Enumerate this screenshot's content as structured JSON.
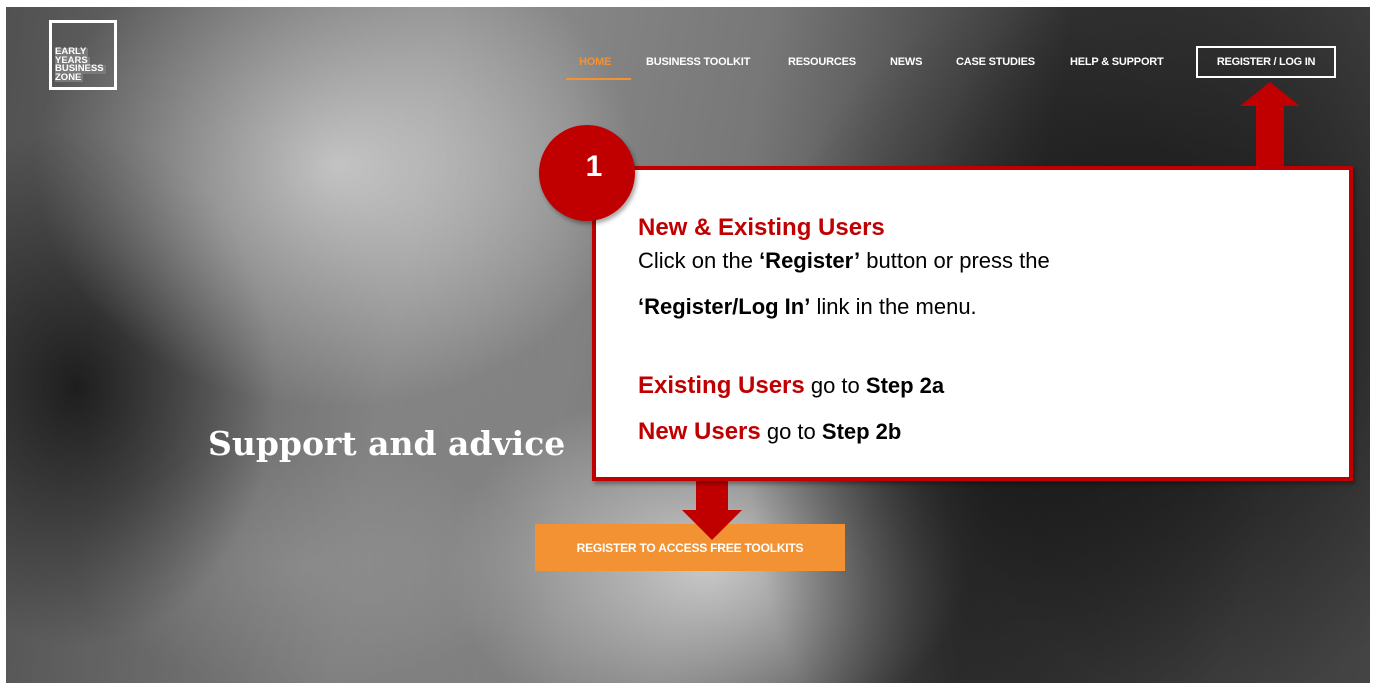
{
  "logo": {
    "lines": [
      "EARLY",
      "YEARS",
      "BUSINESS",
      "ZONE"
    ]
  },
  "nav": {
    "items": [
      "HOME",
      "BUSINESS TOOLKIT",
      "RESOURCES",
      "NEWS",
      "CASE STUDIES",
      "HELP & SUPPORT"
    ],
    "active": "HOME",
    "register_login": "REGISTER / LOG IN"
  },
  "hero": {
    "headline": "Support and advice",
    "cta_label": "REGISTER TO ACCESS FREE TOOLKITS"
  },
  "callout": {
    "step_number": "1",
    "title": "New & Existing Users",
    "line1_pre": "Click on the ",
    "line1_bold": "‘Register’",
    "line1_post": " button or press the",
    "line2_bold": "‘Register/Log In’",
    "line2_post": " link in the menu.",
    "existing_label": "Existing Users",
    "existing_mid": " go to ",
    "existing_step": "Step 2a",
    "new_label": "New Users",
    "new_mid": " go to ",
    "new_step": "Step 2b"
  },
  "colors": {
    "accent": "#f39233",
    "callout_red": "#c00000"
  }
}
